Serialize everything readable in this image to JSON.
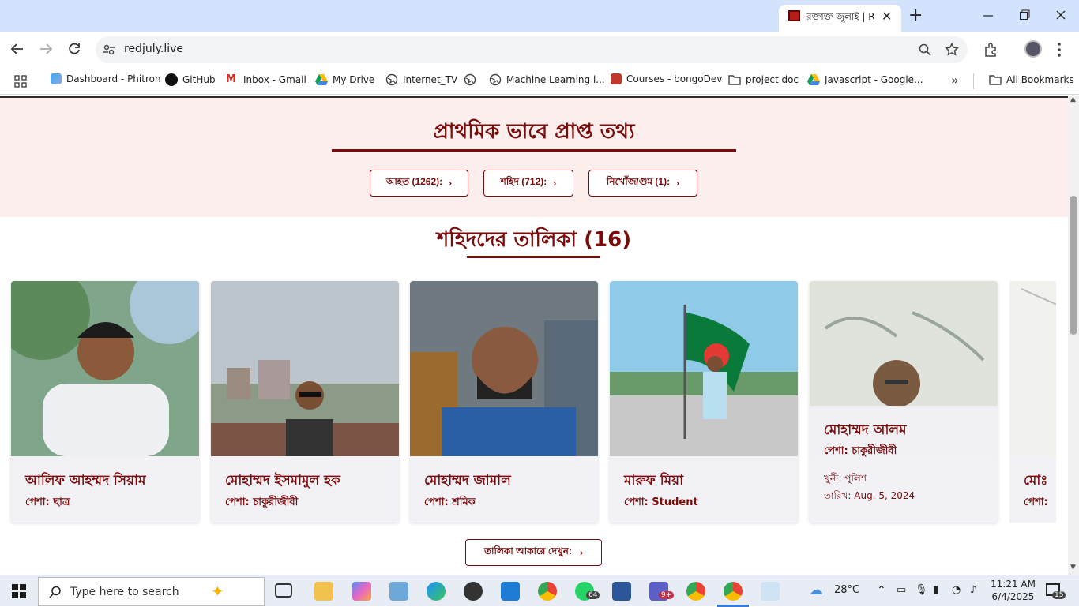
{
  "browser": {
    "tab_title": "রক্তাক্ত জুলাই | R",
    "url": "redjuly.live",
    "bookmarks": [
      {
        "label": "Dashboard - Phitron",
        "icon": "phitron-icon"
      },
      {
        "label": "GitHub",
        "icon": "github-icon"
      },
      {
        "label": "Inbox - Gmail",
        "icon": "gmail-icon"
      },
      {
        "label": "My Drive",
        "icon": "drive-icon"
      },
      {
        "label": "Internet_TV",
        "icon": "globe-icon"
      },
      {
        "label": "",
        "icon": "globe-icon"
      },
      {
        "label": "Machine Learning i...",
        "icon": "globe-icon"
      },
      {
        "label": "Courses - bongoDev",
        "icon": "bongodev-icon"
      },
      {
        "label": "project doc",
        "icon": "folder-icon"
      },
      {
        "label": "Javascript - Google...",
        "icon": "drive-icon"
      }
    ],
    "all_bookmarks": "All Bookmarks"
  },
  "info": {
    "title": "প্রাথমিক ভাবে প্রাপ্ত তথ্য",
    "buttons": [
      "আহত (1262):",
      "শহিদ (712):",
      "নিখোঁজ/গুম (1):"
    ]
  },
  "martyrs": {
    "title": "শহিদদের তালিকা (16)",
    "cards": [
      {
        "name": "আলিফ আহম্মদ সিয়াম",
        "profession": "পেশা: ছাত্র"
      },
      {
        "name": "মোহাম্মদ ইসমামুল হক",
        "profession": "পেশা: চাকুরীজীবী"
      },
      {
        "name": "মোহাম্মদ জামাল",
        "profession": "পেশা: শ্রমিক"
      },
      {
        "name": "মারুফ মিয়া",
        "profession": "পেশা: Student"
      },
      {
        "name": "মোহাম্মদ আলম",
        "profession": "পেশা: চাকুরীজীবী",
        "killer": "খুনী: পুলিশ",
        "date": "তারিখ: Aug. 5, 2024"
      },
      {
        "name": "মোঃ",
        "profession": "পেশা:"
      }
    ],
    "table_button": "তালিকা আকারে দেখুন:"
  },
  "taskbar": {
    "search_placeholder": "Type here to search",
    "temperature": "28°C",
    "time": "11:21 AM",
    "date": "6/4/2025",
    "whatsapp_badge": "64",
    "teams_badge": "9+",
    "notif_badge": "15"
  },
  "colors": {
    "accent": "#7a0b0b",
    "info_bg": "#fdeeee"
  }
}
